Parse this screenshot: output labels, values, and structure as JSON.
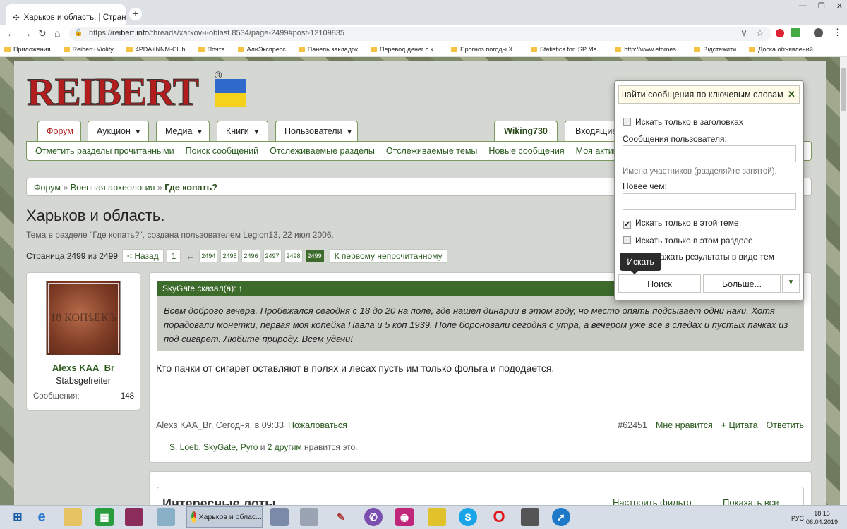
{
  "browser": {
    "tab_title": "Харьков и область. | Страница",
    "url_prefix": "https://",
    "url_host": "reibert.info",
    "url_path": "/threads/xarkov-i-oblast.8534/page-2499#post-12109835",
    "bookmarks": [
      "Приложения",
      "Reibert+Violity",
      "4PDA+NNM-Club",
      "Почта",
      "АлиЭкспресс",
      "Панель закладок",
      "Перевод денег с к...",
      "Прогноз погоды Х...",
      "Statistics for ISP Ma...",
      "http://www.etomes...",
      "Відстежити",
      "Доска объявлений..."
    ]
  },
  "site": {
    "logo": "REIBERT",
    "logo_reg": "®",
    "nav_tabs": [
      {
        "label": "Форум"
      },
      {
        "label": "Аукцион"
      },
      {
        "label": "Медиа"
      },
      {
        "label": "Книги"
      },
      {
        "label": "Пользователи"
      }
    ],
    "user_tab": "Wiking730",
    "login_tab": "Входящие",
    "subnav": [
      "Отметить разделы прочитанными",
      "Поиск сообщений",
      "Отслеживаемые разделы",
      "Отслеживаемые темы",
      "Новые сообщения",
      "Моя активность"
    ],
    "breadcrumb": [
      "Форум",
      "Военная археология",
      "Где копать?"
    ]
  },
  "thread": {
    "title": "Харьков и область.",
    "subtitle": "Тема в разделе \"Где копать?\", создана пользователем Legion13, 22 июл 2006.",
    "pager_label": "Страница 2499 из 2499",
    "prev": "< Назад",
    "first_page": "1",
    "dots": "←",
    "pages": [
      "2494",
      "2495",
      "2496",
      "2497",
      "2498",
      "2499"
    ],
    "unread": "К первому непрочитанному"
  },
  "post": {
    "user": "Alexs KAA_Br",
    "rank": "Stabsgefreiter",
    "messages_label": "Сообщения:",
    "messages_count": "148",
    "avatar_text": "18 КОПѣЕКЪ",
    "quote_head": "SkyGate сказал(а): ↑",
    "quote_text": "Всем доброго вечера. Пробежался сегодня с 18 до 20 на поле, где нашел динарии в этом году, но место опять подсывает одни наки. Хотя порадовали монетки, первая моя копейка Павла и 5 коп 1939. Поле бороновали сегодня с утра, а вечером уже все в следах и пустых пачках из под сигарет. Любите природу. Всем удачи!",
    "text": "Кто пачки от сигарет оставляют в полях и лесах пусть им только фольга и пододается.",
    "meta": "Alexs KAA_Br, Сегодня, в 09:33",
    "report": "Пожаловаться",
    "number": "#62451",
    "like": "Мне нравится",
    "quote": "+ Цитата",
    "reply": "Ответить",
    "likes_users": "S. Loeb, SkyGate, Pyro",
    "likes_and": " и ",
    "likes_others": "2 другим",
    "likes_tail": " нравится это."
  },
  "lots": {
    "title": "Интересные лоты",
    "filter": "Настроить фильтр",
    "all": "Показать все"
  },
  "search": {
    "query": "найти сообщения по ключевым словам",
    "clear": "✕",
    "titles_only": "Искать только в заголовках",
    "user_label": "Сообщения пользователя:",
    "user_hint": "Имена участников (разделяйте запятой).",
    "newer_label": "Новее чем:",
    "this_thread": "Искать только в этой теме",
    "this_forum": "Искать только в этом разделе",
    "as_threads": "Отображать результаты в виде тем",
    "tooltip": "Искать",
    "search_btn": "Поиск",
    "more_btn": "Больше..."
  },
  "taskbar": {
    "chrome_title": "Харьков и облас...",
    "lang": "РУС",
    "time": "18:15",
    "date": "06.04.2019"
  }
}
